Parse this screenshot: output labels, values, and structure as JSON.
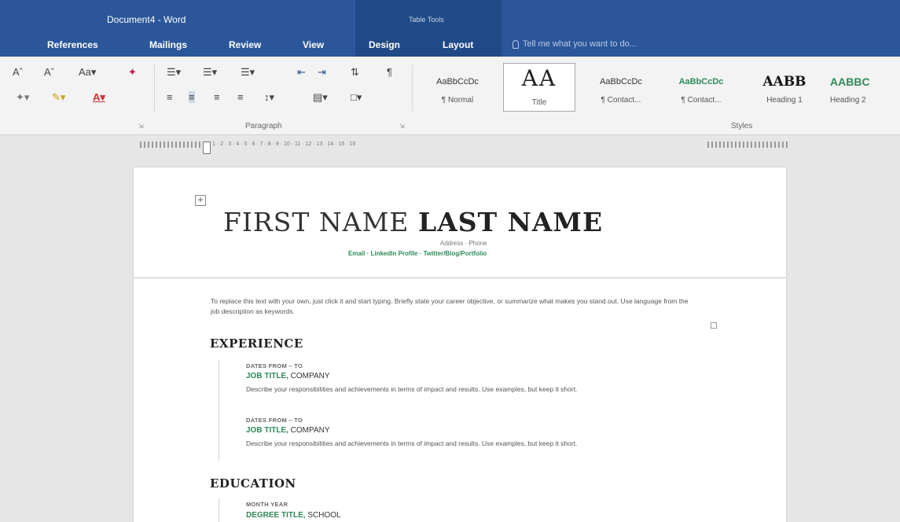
{
  "title_bar": {
    "document_title": "Document4 - Word",
    "contextual_group": "Table Tools"
  },
  "tabs": [
    "References",
    "Mailings",
    "Review",
    "View",
    "Design",
    "Layout"
  ],
  "tell_me": {
    "placeholder": "Tell me what you want to do..."
  },
  "ribbon": {
    "font_group": {
      "grow_font": "Aˆ",
      "shrink_font": "Aˇ",
      "change_case": "Aa▾",
      "clear_formatting": "✦",
      "highlight": "✎▾",
      "font_color": "A▾"
    },
    "paragraph_label": "Paragraph",
    "styles_label": "Styles",
    "styles": [
      {
        "sample": "AaBbCcDc",
        "name": "¶ Normal"
      },
      {
        "sample": "AA",
        "name": "Title"
      },
      {
        "sample": "AaBbCcDc",
        "name": "¶ Contact..."
      },
      {
        "sample": "AaBbCcDc",
        "name": "¶ Contact..."
      },
      {
        "sample": "AABB",
        "name": "Heading 1"
      },
      {
        "sample": "AABBC",
        "name": "Heading 2"
      }
    ]
  },
  "ruler": {
    "ticks": "1 · 2 · 3 · 4 · 5 · 6 · 7 · 8 · 9 · 10 · 11 · 12 · 13 · 14 · 15 · 16"
  },
  "resume": {
    "first_name": "FIRST NAME",
    "last_name": "LAST NAME",
    "address_phone": "Address · Phone",
    "contacts": "Email · LinkedIn Profile · Twitter/Blog/Portfolio",
    "objective": "To replace this text with your own, just click it and start typing. Briefly state your career objective, or summarize what makes you stand out. Use language from the job description as keywords.",
    "experience_heading": "EXPERIENCE",
    "jobs": [
      {
        "dates": "DATES FROM – TO",
        "title": "JOB TITLE,",
        "company": " COMPANY",
        "description": "Describe your responsibilities and achievements in terms of impact and results. Use examples, but keep it short."
      },
      {
        "dates": "DATES FROM – TO",
        "title": "JOB TITLE,",
        "company": " COMPANY",
        "description": "Describe your responsibilities and achievements in terms of impact and results. Use examples, but keep it short."
      }
    ],
    "education_heading": "EDUCATION",
    "education": [
      {
        "dates": "MONTH YEAR",
        "degree": "DEGREE TITLE,",
        "school": " SCHOOL"
      }
    ]
  },
  "colors": {
    "word_blue": "#2b579a",
    "accent_green": "#2e8b57"
  }
}
